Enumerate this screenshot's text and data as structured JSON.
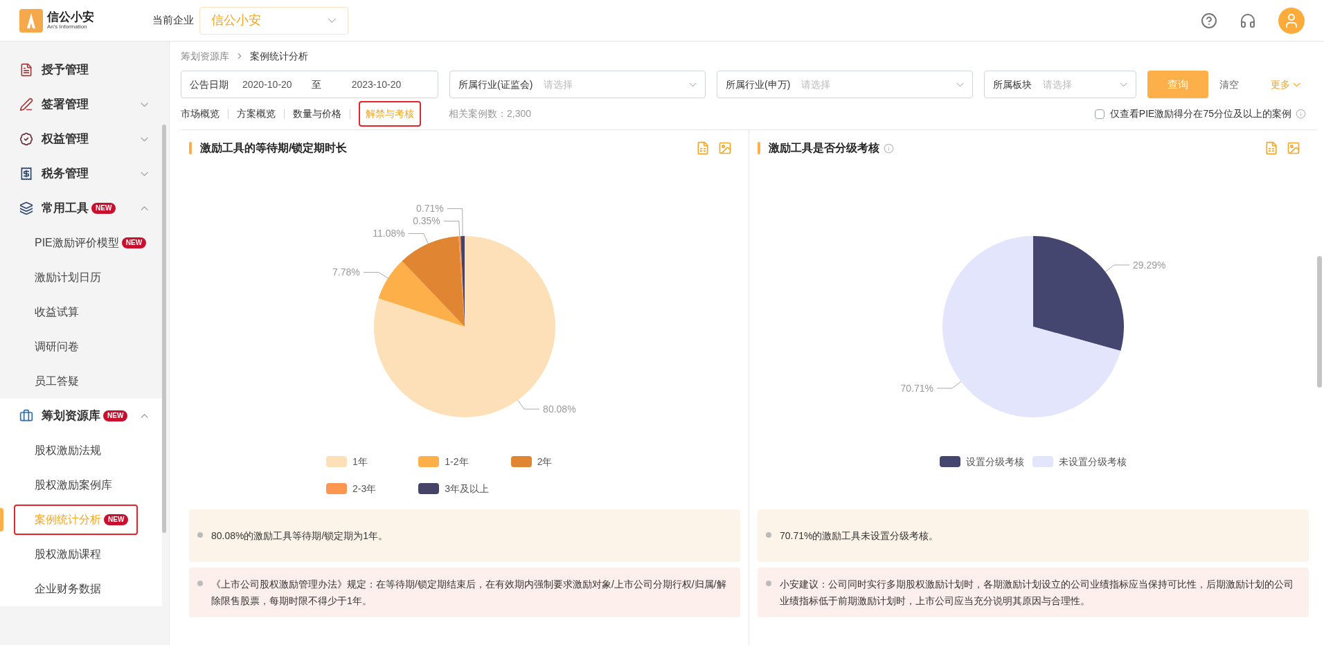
{
  "header": {
    "logo_name": "信公小安",
    "logo_subtitle": "An's Information",
    "company_label": "当前企业",
    "company_value": "信公小安"
  },
  "sidebar": {
    "items": [
      {
        "label": "授予管理"
      },
      {
        "label": "签署管理",
        "expanded": false
      },
      {
        "label": "权益管理",
        "expanded": false
      },
      {
        "label": "税务管理",
        "expanded": false
      },
      {
        "label": "常用工具",
        "badge": "NEW",
        "expanded": true,
        "children": [
          {
            "label": "PIE激励评价模型",
            "badge": "NEW",
            "selected": false
          },
          {
            "label": "激励计划日历",
            "selected": false
          },
          {
            "label": "收益试算",
            "selected": false
          },
          {
            "label": "调研问卷",
            "selected": false
          },
          {
            "label": "员工答疑",
            "selected": false
          }
        ]
      },
      {
        "label": "筹划资源库",
        "badge": "NEW",
        "expanded": true,
        "children": [
          {
            "label": "股权激励法规",
            "selected": false
          },
          {
            "label": "股权激励案例库",
            "selected": false
          },
          {
            "label": "案例统计分析",
            "badge": "NEW",
            "selected": true
          },
          {
            "label": "股权激励课程",
            "selected": false
          },
          {
            "label": "企业财务数据",
            "selected": false
          }
        ]
      }
    ]
  },
  "breadcrumb": [
    "筹划资源库",
    "案例统计分析"
  ],
  "filters": {
    "date": {
      "label": "公告日期",
      "start": "2020-10-20",
      "separator": "至",
      "end": "2023-10-20"
    },
    "selects": [
      {
        "label": "所属行业(证监会)",
        "placeholder": "请选择"
      },
      {
        "label": "所属行业(申万)",
        "placeholder": "请选择"
      },
      {
        "label": "所属板块",
        "placeholder": "请选择"
      }
    ],
    "query_button": "查询",
    "clear_link": "清空",
    "more_link": "更多"
  },
  "tabs": [
    {
      "label": "市场概览",
      "selected": false
    },
    {
      "label": "方案概览",
      "selected": false
    },
    {
      "label": "数量与价格",
      "selected": false
    },
    {
      "label": "解禁与考核",
      "selected": true
    }
  ],
  "case_count": "相关案例数：2,300",
  "filter_checkbox": {
    "label": "仅查看PIE激励得分在75分位及以上的案例",
    "checked": false
  },
  "panels": [
    {
      "title": "激励工具的等待期/锁定期时长",
      "has_info": false,
      "chart_data": {
        "type": "pie",
        "categories": [
          "1年",
          "1-2年",
          "2年",
          "2-3年",
          "3年及以上"
        ],
        "values": [
          80.08,
          7.78,
          11.08,
          0.35,
          0.71
        ],
        "value_labels": [
          "80.08%",
          "7.78%",
          "11.08%",
          "0.35%",
          "0.71%"
        ],
        "colors": [
          "#fde0b8",
          "#fdb04a",
          "#e08632",
          "#fd9650",
          "#454468"
        ]
      },
      "notes": [
        {
          "kind": "summary",
          "text": "80.08%的激励工具等待期/锁定期为1年。"
        },
        {
          "kind": "rule",
          "text": "《上市公司股权激励管理办法》规定：在等待期/锁定期结束后，在有效期内强制要求激励对象/上市公司分期行权/归属/解除限售股票，每期时限不得少于1年。"
        }
      ]
    },
    {
      "title": "激励工具是否分级考核",
      "has_info": true,
      "chart_data": {
        "type": "pie",
        "categories": [
          "设置分级考核",
          "未设置分级考核"
        ],
        "values": [
          29.29,
          70.71
        ],
        "value_labels": [
          "29.29%",
          "70.71%"
        ],
        "colors": [
          "#454670",
          "#e3e5fd"
        ]
      },
      "notes": [
        {
          "kind": "summary",
          "text": "70.71%的激励工具未设置分级考核。"
        },
        {
          "kind": "rule",
          "text": "小安建议：公司同时实行多期股权激励计划时，各期激励计划设立的公司业绩指标应当保持可比性，后期激励计划的公司业绩指标低于前期激励计划时，上市公司应当充分说明其原因与合理性。"
        }
      ]
    }
  ]
}
